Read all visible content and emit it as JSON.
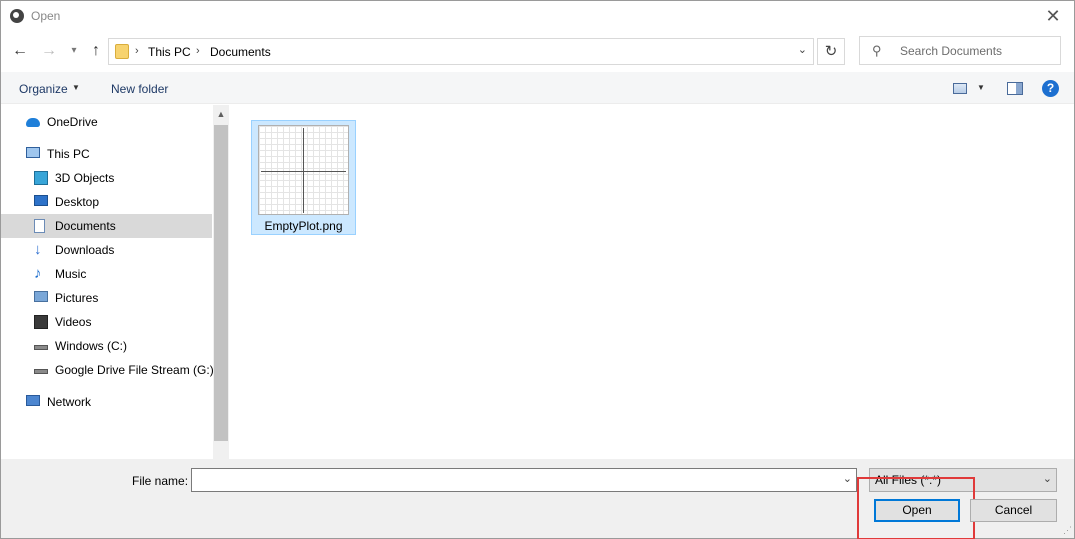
{
  "window": {
    "title": "Open",
    "close_glyph": "✕"
  },
  "address": {
    "crumbs": [
      "This PC",
      "Documents"
    ],
    "search_placeholder": "Search Documents"
  },
  "toolbar": {
    "organize_label": "Organize",
    "new_folder_label": "New folder",
    "help_glyph": "?"
  },
  "nav": {
    "items": [
      {
        "label": "OneDrive",
        "icon": "cloud-icon",
        "level": 0
      },
      {
        "label": "This PC",
        "icon": "monitor-icon",
        "level": 0
      },
      {
        "label": "3D Objects",
        "icon": "cube-icon",
        "level": 1
      },
      {
        "label": "Desktop",
        "icon": "desktop-icon",
        "level": 1
      },
      {
        "label": "Documents",
        "icon": "document-icon",
        "level": 1,
        "selected": true
      },
      {
        "label": "Downloads",
        "icon": "download-icon",
        "level": 1
      },
      {
        "label": "Music",
        "icon": "music-icon",
        "level": 1
      },
      {
        "label": "Pictures",
        "icon": "pictures-icon",
        "level": 1
      },
      {
        "label": "Videos",
        "icon": "videos-icon",
        "level": 1
      },
      {
        "label": "Windows (C:)",
        "icon": "drive-icon",
        "level": 1
      },
      {
        "label": "Google Drive File Stream (G:)",
        "icon": "drive-icon",
        "level": 1
      },
      {
        "label": "Network",
        "icon": "network-icon",
        "level": 0
      }
    ]
  },
  "files": [
    {
      "name": "EmptyPlot.png",
      "selected": true
    }
  ],
  "bottom": {
    "file_name_label": "File name:",
    "file_name_value": "",
    "filter_value": "All Files (*.*)",
    "open_label": "Open",
    "cancel_label": "Cancel"
  },
  "colors": {
    "accent": "#0078d7",
    "selection": "#cce8ff",
    "highlight": "#e03a3a"
  }
}
